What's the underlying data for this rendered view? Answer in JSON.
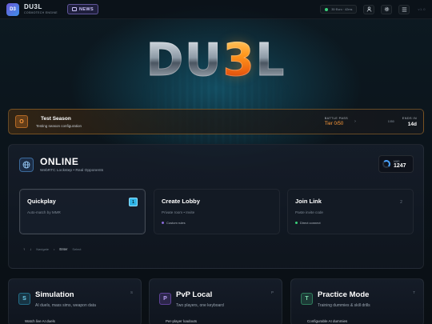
{
  "header": {
    "badge": "D3",
    "app_name": "DU3L",
    "app_sub": "COSMOTECH ENGINE",
    "news_label": "NEWS",
    "status_text": "35·Euro  ·  42ms",
    "version": "v1.0"
  },
  "logo": {
    "left": "DU",
    "mid": "3",
    "right": "L"
  },
  "season": {
    "badge": "O",
    "title": "Test Season",
    "desc": "Testing season configuration",
    "bp_label": "BATTLE PASS",
    "bp_tier": "Tier 0/50",
    "small_label": "1050",
    "ends_label": "ENDS IN",
    "ends_value": "14d"
  },
  "online": {
    "title": "ONLINE",
    "subtitle": "WebRTC Lockstep • Real Opponents",
    "mmr_label": "MMR",
    "mmr_value": "1247",
    "cards": [
      {
        "title": "Quickplay",
        "desc": "Auto-match by MMR",
        "key": "1",
        "tag": ""
      },
      {
        "title": "Create Lobby",
        "desc": "Private room • Invite",
        "key": "",
        "tag": "Custom rules"
      },
      {
        "title": "Join Link",
        "desc": "Paste invite code",
        "key": "2",
        "tag": "Direct connect"
      }
    ],
    "hint": {
      "k1": "↑",
      "k2": "↓",
      "nav": "Navigate",
      "k3": "Enter",
      "sel": "Select"
    }
  },
  "modes": [
    {
      "icon": "S",
      "title": "Simulation",
      "sub": "AI duels, mass sims, weapon data",
      "key": "S",
      "item": "Watch live AI duels",
      "color": "#2fa3c8"
    },
    {
      "icon": "P",
      "title": "PvP Local",
      "sub": "Two players, one keyboard",
      "key": "P",
      "item": "Per-player loadouts",
      "color": "#8a5ad8"
    },
    {
      "icon": "T",
      "title": "Practice Mode",
      "sub": "Training dummies & skill drills",
      "key": "T",
      "item": "Configurable AI dummies",
      "color": "#3fb37a"
    }
  ],
  "colors": {
    "accent": "#ff9a3a",
    "online": "#4aa3ff"
  }
}
